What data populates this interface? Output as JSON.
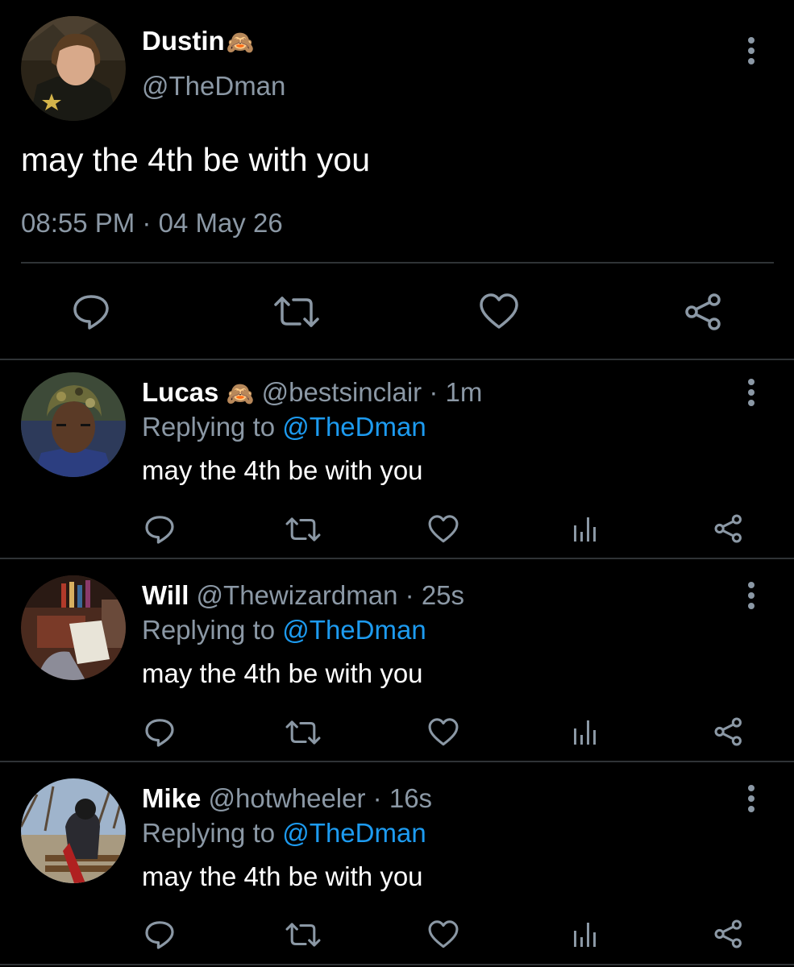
{
  "main_tweet": {
    "display_name": "Dustin",
    "name_emoji": "🙈",
    "handle": "@TheDman",
    "text": "may the 4th be with you",
    "time": "08:55 PM",
    "separator": "·",
    "date": "04 May 26"
  },
  "replies": [
    {
      "display_name": "Lucas",
      "name_emoji": "🙈",
      "handle": "@bestsinclair",
      "separator": "·",
      "age": "1m",
      "replying_prefix": "Replying to",
      "replying_to": "@TheDman",
      "text": "may the 4th be with you"
    },
    {
      "display_name": "Will",
      "handle": "@Thewizardman",
      "separator": "·",
      "age": "25s",
      "replying_prefix": "Replying to",
      "replying_to": "@TheDman",
      "text": "may the 4th be with you"
    },
    {
      "display_name": "Mike",
      "handle": "@hotwheeler",
      "separator": "·",
      "age": "16s",
      "replying_prefix": "Replying to",
      "replying_to": "@TheDman",
      "text": "may the 4th be with you"
    }
  ],
  "icons": {
    "reply": "reply-icon",
    "retweet": "retweet-icon",
    "like": "heart-icon",
    "stats": "stats-icon",
    "share": "share-icon",
    "more": "more-icon"
  },
  "colors": {
    "background": "#000000",
    "text": "#ffffff",
    "secondary": "#8b98a5",
    "link": "#1d9bf0",
    "divider": "#2f3336"
  }
}
